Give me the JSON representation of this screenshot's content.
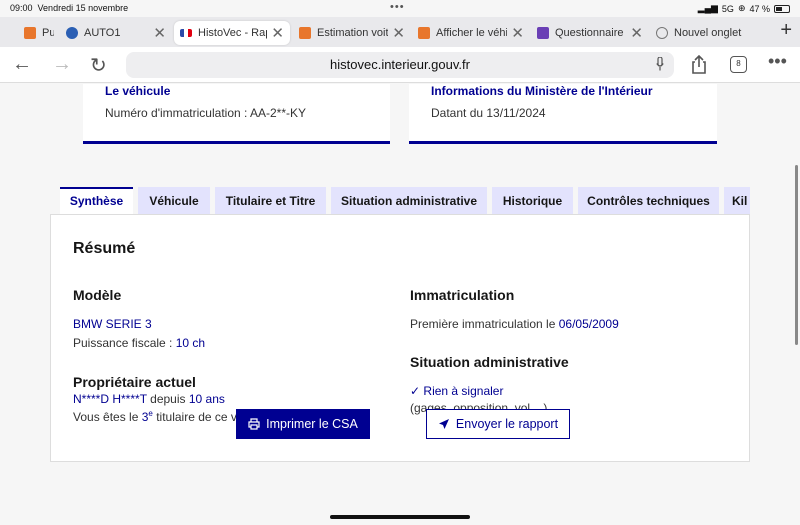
{
  "status": {
    "time": "09:00",
    "date": "Vendredi 15 novembre",
    "network": "5G",
    "battery": "47 %"
  },
  "browser_tabs": [
    {
      "label": "Pu",
      "color": "#e8762c"
    },
    {
      "label": "AUTO1",
      "color": "#2b5fb4"
    },
    {
      "label": "HistoVec - Rapport",
      "color": "#2b4aa8"
    },
    {
      "label": "Estimation voiture",
      "color": "#e8762c"
    },
    {
      "label": "Afficher le véhicule",
      "color": "#e8762c"
    },
    {
      "label": "Questionnaire",
      "color": "#6a3fb5"
    },
    {
      "label": "Nouvel onglet",
      "color": "#777777"
    }
  ],
  "url": "histovec.interieur.gouv.fr",
  "tabs_count": "8",
  "cards": {
    "vehicle": {
      "title": "Le véhicule",
      "subtitle": "Numéro d'immatriculation : AA-2**-KY"
    },
    "ministry": {
      "title": "Informations du Ministère de l'Intérieur",
      "subtitle": "Datant du 13/11/2024"
    }
  },
  "page_tabs": [
    "Synthèse",
    "Véhicule",
    "Titulaire et Titre",
    "Situation administrative",
    "Historique",
    "Contrôles techniques",
    "Kil"
  ],
  "summary": {
    "title": "Résumé",
    "model_heading": "Modèle",
    "model_value": "BMW SERIE 3",
    "puissance_label": "Puissance fiscale : ",
    "puissance_value": "10 ch",
    "owner_heading": "Propriétaire actuel",
    "owner_name": "N****D H****T",
    "owner_since_label": " depuis ",
    "owner_since_value": "10 ans",
    "titulaire_prefix": "Vous êtes le ",
    "titulaire_rank": "3",
    "titulaire_sup": "e",
    "titulaire_suffix": " titulaire de ce véhicule",
    "immat_heading": "Immatriculation",
    "immat_label": "Première immatriculation le ",
    "immat_date": "06/05/2009",
    "situation_heading": "Situation administrative",
    "situation_value": "Rien à signaler",
    "situation_detail": "(gages, opposition, vol,...)"
  },
  "buttons": {
    "print": "Imprimer le CSA",
    "send": "Envoyer le rapport"
  }
}
